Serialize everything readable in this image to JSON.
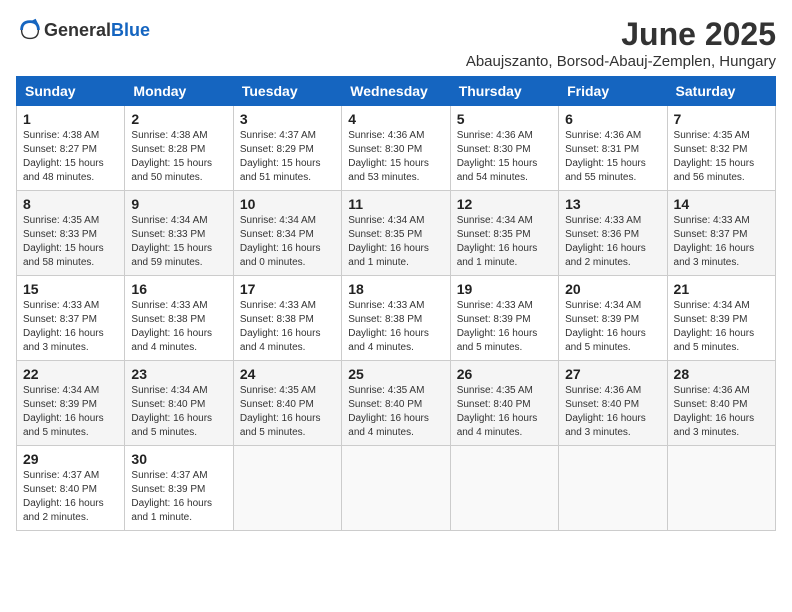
{
  "header": {
    "logo_general": "General",
    "logo_blue": "Blue",
    "title": "June 2025",
    "subtitle": "Abaujszanto, Borsod-Abauj-Zemplen, Hungary"
  },
  "weekdays": [
    "Sunday",
    "Monday",
    "Tuesday",
    "Wednesday",
    "Thursday",
    "Friday",
    "Saturday"
  ],
  "weeks": [
    [
      {
        "day": "1",
        "info": "Sunrise: 4:38 AM\nSunset: 8:27 PM\nDaylight: 15 hours\nand 48 minutes."
      },
      {
        "day": "2",
        "info": "Sunrise: 4:38 AM\nSunset: 8:28 PM\nDaylight: 15 hours\nand 50 minutes."
      },
      {
        "day": "3",
        "info": "Sunrise: 4:37 AM\nSunset: 8:29 PM\nDaylight: 15 hours\nand 51 minutes."
      },
      {
        "day": "4",
        "info": "Sunrise: 4:36 AM\nSunset: 8:30 PM\nDaylight: 15 hours\nand 53 minutes."
      },
      {
        "day": "5",
        "info": "Sunrise: 4:36 AM\nSunset: 8:30 PM\nDaylight: 15 hours\nand 54 minutes."
      },
      {
        "day": "6",
        "info": "Sunrise: 4:36 AM\nSunset: 8:31 PM\nDaylight: 15 hours\nand 55 minutes."
      },
      {
        "day": "7",
        "info": "Sunrise: 4:35 AM\nSunset: 8:32 PM\nDaylight: 15 hours\nand 56 minutes."
      }
    ],
    [
      {
        "day": "8",
        "info": "Sunrise: 4:35 AM\nSunset: 8:33 PM\nDaylight: 15 hours\nand 58 minutes."
      },
      {
        "day": "9",
        "info": "Sunrise: 4:34 AM\nSunset: 8:33 PM\nDaylight: 15 hours\nand 59 minutes."
      },
      {
        "day": "10",
        "info": "Sunrise: 4:34 AM\nSunset: 8:34 PM\nDaylight: 16 hours\nand 0 minutes."
      },
      {
        "day": "11",
        "info": "Sunrise: 4:34 AM\nSunset: 8:35 PM\nDaylight: 16 hours\nand 1 minute."
      },
      {
        "day": "12",
        "info": "Sunrise: 4:34 AM\nSunset: 8:35 PM\nDaylight: 16 hours\nand 1 minute."
      },
      {
        "day": "13",
        "info": "Sunrise: 4:33 AM\nSunset: 8:36 PM\nDaylight: 16 hours\nand 2 minutes."
      },
      {
        "day": "14",
        "info": "Sunrise: 4:33 AM\nSunset: 8:37 PM\nDaylight: 16 hours\nand 3 minutes."
      }
    ],
    [
      {
        "day": "15",
        "info": "Sunrise: 4:33 AM\nSunset: 8:37 PM\nDaylight: 16 hours\nand 3 minutes."
      },
      {
        "day": "16",
        "info": "Sunrise: 4:33 AM\nSunset: 8:38 PM\nDaylight: 16 hours\nand 4 minutes."
      },
      {
        "day": "17",
        "info": "Sunrise: 4:33 AM\nSunset: 8:38 PM\nDaylight: 16 hours\nand 4 minutes."
      },
      {
        "day": "18",
        "info": "Sunrise: 4:33 AM\nSunset: 8:38 PM\nDaylight: 16 hours\nand 4 minutes."
      },
      {
        "day": "19",
        "info": "Sunrise: 4:33 AM\nSunset: 8:39 PM\nDaylight: 16 hours\nand 5 minutes."
      },
      {
        "day": "20",
        "info": "Sunrise: 4:34 AM\nSunset: 8:39 PM\nDaylight: 16 hours\nand 5 minutes."
      },
      {
        "day": "21",
        "info": "Sunrise: 4:34 AM\nSunset: 8:39 PM\nDaylight: 16 hours\nand 5 minutes."
      }
    ],
    [
      {
        "day": "22",
        "info": "Sunrise: 4:34 AM\nSunset: 8:39 PM\nDaylight: 16 hours\nand 5 minutes."
      },
      {
        "day": "23",
        "info": "Sunrise: 4:34 AM\nSunset: 8:40 PM\nDaylight: 16 hours\nand 5 minutes."
      },
      {
        "day": "24",
        "info": "Sunrise: 4:35 AM\nSunset: 8:40 PM\nDaylight: 16 hours\nand 5 minutes."
      },
      {
        "day": "25",
        "info": "Sunrise: 4:35 AM\nSunset: 8:40 PM\nDaylight: 16 hours\nand 4 minutes."
      },
      {
        "day": "26",
        "info": "Sunrise: 4:35 AM\nSunset: 8:40 PM\nDaylight: 16 hours\nand 4 minutes."
      },
      {
        "day": "27",
        "info": "Sunrise: 4:36 AM\nSunset: 8:40 PM\nDaylight: 16 hours\nand 3 minutes."
      },
      {
        "day": "28",
        "info": "Sunrise: 4:36 AM\nSunset: 8:40 PM\nDaylight: 16 hours\nand 3 minutes."
      }
    ],
    [
      {
        "day": "29",
        "info": "Sunrise: 4:37 AM\nSunset: 8:40 PM\nDaylight: 16 hours\nand 2 minutes."
      },
      {
        "day": "30",
        "info": "Sunrise: 4:37 AM\nSunset: 8:39 PM\nDaylight: 16 hours\nand 1 minute."
      },
      {
        "day": "",
        "info": ""
      },
      {
        "day": "",
        "info": ""
      },
      {
        "day": "",
        "info": ""
      },
      {
        "day": "",
        "info": ""
      },
      {
        "day": "",
        "info": ""
      }
    ]
  ]
}
